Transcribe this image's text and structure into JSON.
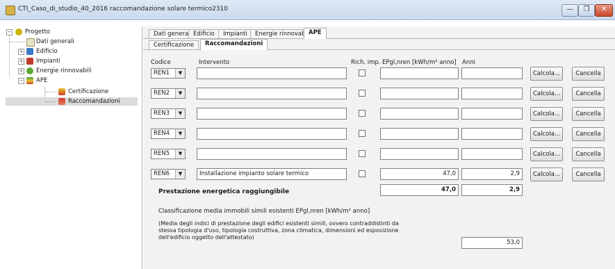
{
  "window": {
    "title": "CTI_Caso_di_studio_40_2016 raccomandazione solare termico2310",
    "controls": [
      "—",
      "❐",
      "✕"
    ]
  },
  "tree": {
    "root": "Progetto",
    "children": [
      "Dati generali",
      "Edificio",
      "Impianti",
      "Energie rinnovabili",
      "APE"
    ],
    "ape_children": [
      "Certificazione",
      "Raccomandazioni"
    ]
  },
  "tabs": {
    "main": [
      "Dati generali",
      "Edificio",
      "Impianti",
      "Energie rinnovabili",
      "APE"
    ],
    "sub": [
      "Certificazione",
      "Raccomandazioni"
    ]
  },
  "table": {
    "headers": {
      "code": "Codice",
      "intervention": "Intervento",
      "rich": "Rich. imp.",
      "ep": "EPgl,nren [kWh/m² anno]",
      "years": "Anni"
    },
    "rows": [
      {
        "code": "REN1",
        "intervention": "",
        "ep": "",
        "years": ""
      },
      {
        "code": "REN2",
        "intervention": "",
        "ep": "",
        "years": ""
      },
      {
        "code": "REN3",
        "intervention": "",
        "ep": "",
        "years": ""
      },
      {
        "code": "REN4",
        "intervention": "",
        "ep": "",
        "years": ""
      },
      {
        "code": "REN5",
        "intervention": "",
        "ep": "",
        "years": ""
      },
      {
        "code": "REN6",
        "intervention": "Installazione impianto solare termico",
        "ep": "47,0",
        "years": "2,9"
      }
    ],
    "calc_label": "Calcola...",
    "cancel_label": "Cancella"
  },
  "summary": {
    "label": "Prestazione energetica raggiungibile",
    "ep": "47,0",
    "years": "2,9"
  },
  "classification": {
    "title": "Classificazione media immobili simili esistenti EPgl,nren [kWh/m² anno]",
    "note_line1": "(Media degli indici di prestazione degli edifici esistenti simili, ovvero contraddistinti da",
    "note_line2": "stessa tipologia d'uso, tipologia costruttiva, zona climatica, dimensioni ed esposizione",
    "note_line3": "dell'edificio oggetto dell'attestato)",
    "value": "53,0"
  }
}
